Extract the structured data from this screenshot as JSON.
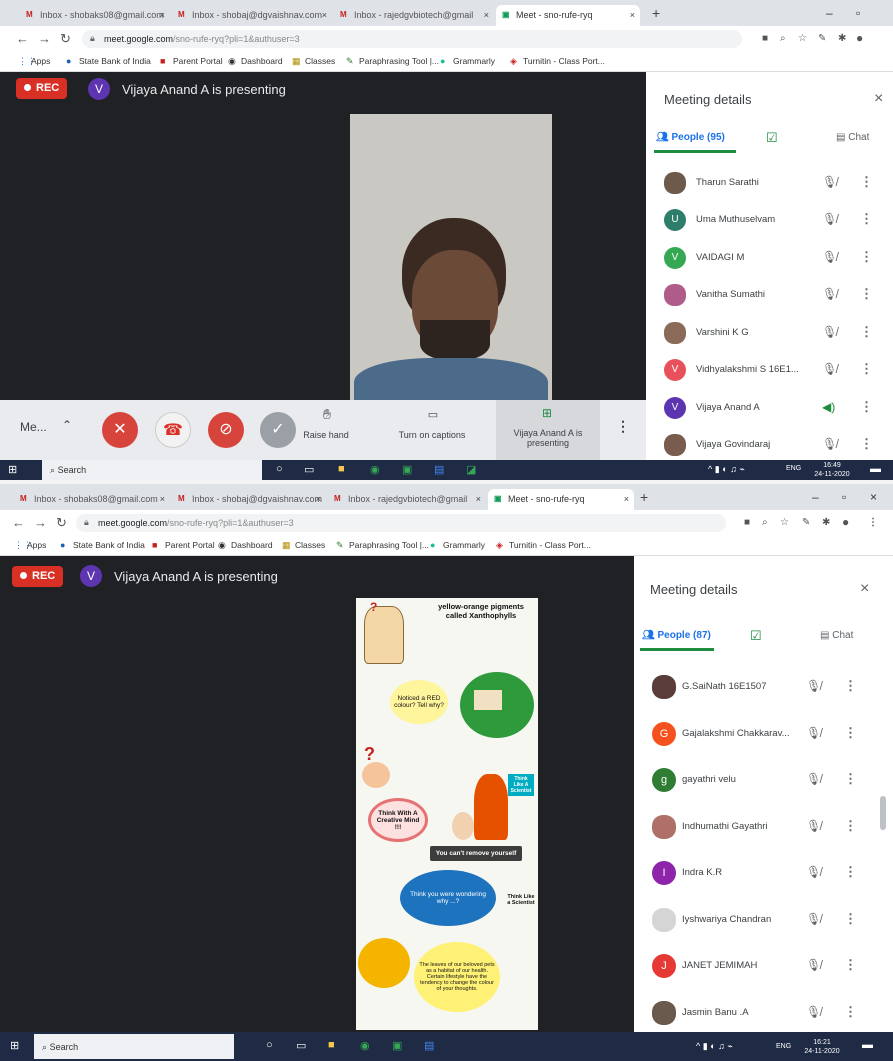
{
  "shot1": {
    "tabs": [
      {
        "label": "Inbox - shobaks08@gmail.com",
        "icon": "gmail-icon"
      },
      {
        "label": "Inbox - shobaj@dgvaishnav.com",
        "icon": "gmail-icon"
      },
      {
        "label": "Inbox - rajedgvbiotech@gmail",
        "icon": "gmail-icon"
      },
      {
        "label": "Meet - sno-rufe-ryq",
        "icon": "meet-icon"
      }
    ],
    "url_host": "meet.google.com",
    "url_rest": "/sno-rufe-ryq?pli=1&authuser=3",
    "bookmarks": [
      "Apps",
      "State Bank of India",
      "Parent Portal",
      "Dashboard",
      "Classes",
      "Paraphrasing Tool |...",
      "Grammarly",
      "Turnitin - Class Port..."
    ],
    "rec": "REC",
    "presenter_avatar": "V",
    "presenting_text": "Vijaya Anand A is presenting",
    "controls": {
      "me_label": "Me...",
      "raise_hand": "Raise hand",
      "captions": "Turn on captions",
      "presenting_label": "Vijaya Anand A is presenting"
    },
    "panel": {
      "title": "Meeting details",
      "people_tab": "People (95)",
      "chat_tab": "Chat",
      "people": [
        {
          "name": "Tharun Sarathi",
          "avatar": "",
          "color": "#6d5a4a",
          "type": "photo",
          "mic": "muted"
        },
        {
          "name": "Uma Muthuselvam",
          "avatar": "U",
          "color": "#2e7d6a",
          "type": "letter",
          "mic": "muted"
        },
        {
          "name": "VAIDAGI M",
          "avatar": "V",
          "color": "#34a853",
          "type": "letter",
          "mic": "muted"
        },
        {
          "name": "Vanitha Sumathi",
          "avatar": "",
          "color": "#b05c8a",
          "type": "photo",
          "mic": "muted"
        },
        {
          "name": "Varshini K G",
          "avatar": "",
          "color": "#8a6b5a",
          "type": "photo",
          "mic": "muted"
        },
        {
          "name": "Vidhyalakshmi S 16E1...",
          "avatar": "V",
          "color": "#e8505b",
          "type": "letter",
          "mic": "muted"
        },
        {
          "name": "Vijaya Anand A",
          "avatar": "V",
          "color": "#5e35b1",
          "type": "letter",
          "mic": "active"
        },
        {
          "name": "Vijaya Govindaraj",
          "avatar": "",
          "color": "#7a5c4e",
          "type": "photo",
          "mic": "muted"
        }
      ]
    },
    "taskbar": {
      "search": "Search",
      "time": "16:49",
      "date": "24-11-2020",
      "lang": "ENG"
    }
  },
  "shot2": {
    "tabs": [
      {
        "label": "Inbox - shobaks08@gmail.com",
        "icon": "gmail-icon"
      },
      {
        "label": "Inbox - shobaj@dgvaishnav.com",
        "icon": "gmail-icon"
      },
      {
        "label": "Inbox - rajedgvbiotech@gmail",
        "icon": "gmail-icon"
      },
      {
        "label": "Meet - sno-rufe-ryq",
        "icon": "meet-icon"
      }
    ],
    "url_host": "meet.google.com",
    "url_rest": "/sno-rufe-ryq?pli=1&authuser=3",
    "bookmarks": [
      "Apps",
      "State Bank of India",
      "Parent Portal",
      "Dashboard",
      "Classes",
      "Paraphrasing Tool |...",
      "Grammarly",
      "Turnitin - Class Port..."
    ],
    "rec": "REC",
    "presenter_avatar": "V",
    "presenting_text": "Vijaya Anand A is presenting",
    "poster": {
      "top_text": "yellow-orange pigments called Xanthophylls",
      "q1": "Noticed a RED colour? Tell why?",
      "think": "Think With A Creative Mind !!!",
      "side": "Think Like A Scientist",
      "remove": "You can't remove yourself",
      "q2": "Think you were wondering why ...?",
      "side2": "Think Like a Scientist",
      "bottom": "The leaves of our beloved pets as a habitat of our health. Certain lifestyle have the tendency to change the colour of your thoughts."
    },
    "panel": {
      "title": "Meeting details",
      "people_tab": "People (87)",
      "chat_tab": "Chat",
      "people": [
        {
          "name": "G.SaiNath 16E1507",
          "avatar": "",
          "color": "#5a3d3a",
          "type": "photo",
          "mic": "muted"
        },
        {
          "name": "Gajalakshmi Chakkarav...",
          "avatar": "G",
          "color": "#f4511e",
          "type": "letter",
          "mic": "muted"
        },
        {
          "name": "gayathri velu",
          "avatar": "g",
          "color": "#2e7d32",
          "type": "letter",
          "mic": "muted"
        },
        {
          "name": "Indhumathi Gayathri",
          "avatar": "",
          "color": "#b0706a",
          "type": "photo",
          "mic": "muted"
        },
        {
          "name": "Indra K.R",
          "avatar": "I",
          "color": "#8e24aa",
          "type": "letter",
          "mic": "muted"
        },
        {
          "name": "Iyshwariya Chandran",
          "avatar": "",
          "color": "#d5d5d5",
          "type": "photo",
          "mic": "muted"
        },
        {
          "name": "JANET JEMIMAH",
          "avatar": "J",
          "color": "#e53935",
          "type": "letter",
          "mic": "muted"
        },
        {
          "name": "Jasmin Banu .A",
          "avatar": "",
          "color": "#6a5a4e",
          "type": "photo",
          "mic": "muted"
        }
      ]
    },
    "taskbar": {
      "search": "Search",
      "time": "16:21",
      "date": "24-11-2020",
      "lang": "ENG"
    }
  }
}
